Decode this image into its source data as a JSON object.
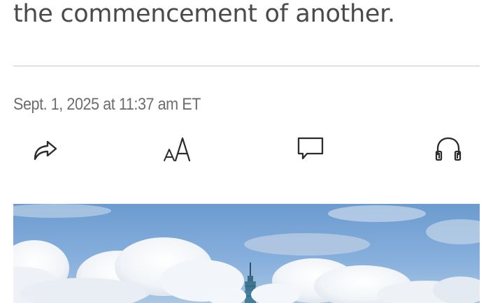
{
  "article": {
    "subhead_tail": "the commencement of another.",
    "timestamp": "Sept. 1, 2025 at 11:37 am ET"
  },
  "toolbar": {
    "items": [
      {
        "icon": "share-arrow-icon"
      },
      {
        "icon": "text-size-icon"
      },
      {
        "icon": "comment-bubble-icon"
      },
      {
        "icon": "headphones-icon"
      }
    ]
  },
  "hero": {
    "icon_color_hex": "#2c2c2c",
    "sky_color_hex": "#7aa7d6"
  }
}
